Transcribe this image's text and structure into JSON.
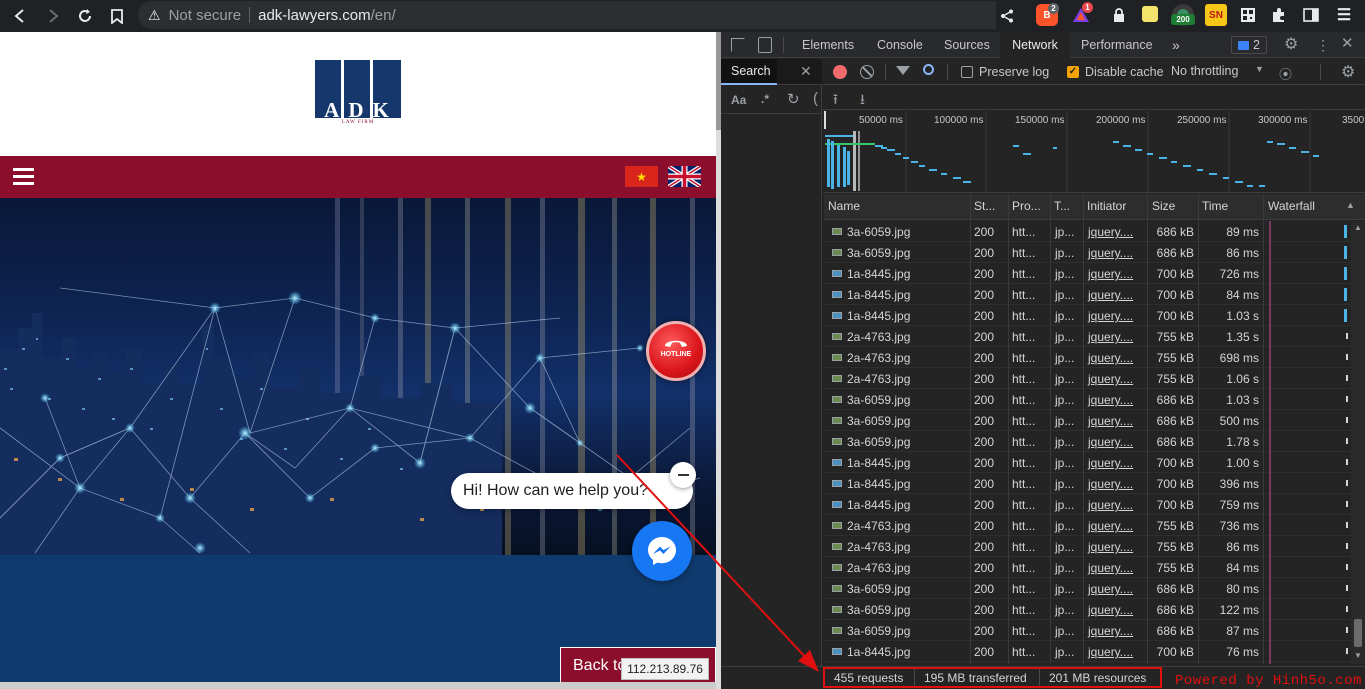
{
  "browser": {
    "security_label": "Not secure",
    "url_host": "adk-lawyers.com",
    "url_path": "/en/",
    "badge_brave": "2",
    "badge_alert": "1",
    "badge_200": "200",
    "badge_sn": "SN"
  },
  "page": {
    "logo_text": "ADK",
    "logo_sub": "LAW FIRM",
    "hotline": "HOTLINE",
    "chat_prompt": "Hi! How can we help you?",
    "back_button": "Back to",
    "ip_tooltip": "112.213.89.76",
    "colors": {
      "brand": "#8b0e2c",
      "navy": "#0f3a6e",
      "messenger": "#1877f2"
    }
  },
  "devtools": {
    "tabs": [
      "Elements",
      "Console",
      "Sources",
      "Network",
      "Performance"
    ],
    "active_tab": "Network",
    "issues_count": "2",
    "search_label": "Search",
    "preserve_log": "Preserve log",
    "disable_cache": "Disable cache",
    "throttling": "No throttling",
    "timeline_ticks": [
      "50000 ms",
      "100000 ms",
      "150000 ms",
      "200000 ms",
      "250000 ms",
      "300000 ms",
      "3500"
    ],
    "columns": [
      "Name",
      "St...",
      "Pro...",
      "T...",
      "Initiator",
      "Size",
      "Time",
      "Waterfall"
    ],
    "rows": [
      {
        "name": "3a-6059.jpg",
        "status": "200",
        "proto": "htt...",
        "type": "jp...",
        "initiator": "jquery....",
        "size": "686 kB",
        "time": "89 ms"
      },
      {
        "name": "3a-6059.jpg",
        "status": "200",
        "proto": "htt...",
        "type": "jp...",
        "initiator": "jquery....",
        "size": "686 kB",
        "time": "86 ms"
      },
      {
        "name": "1a-8445.jpg",
        "status": "200",
        "proto": "htt...",
        "type": "jp...",
        "initiator": "jquery....",
        "size": "700 kB",
        "time": "726 ms"
      },
      {
        "name": "1a-8445.jpg",
        "status": "200",
        "proto": "htt...",
        "type": "jp...",
        "initiator": "jquery....",
        "size": "700 kB",
        "time": "84 ms"
      },
      {
        "name": "1a-8445.jpg",
        "status": "200",
        "proto": "htt...",
        "type": "jp...",
        "initiator": "jquery....",
        "size": "700 kB",
        "time": "1.03 s"
      },
      {
        "name": "2a-4763.jpg",
        "status": "200",
        "proto": "htt...",
        "type": "jp...",
        "initiator": "jquery....",
        "size": "755 kB",
        "time": "1.35 s"
      },
      {
        "name": "2a-4763.jpg",
        "status": "200",
        "proto": "htt...",
        "type": "jp...",
        "initiator": "jquery....",
        "size": "755 kB",
        "time": "698 ms"
      },
      {
        "name": "2a-4763.jpg",
        "status": "200",
        "proto": "htt...",
        "type": "jp...",
        "initiator": "jquery....",
        "size": "755 kB",
        "time": "1.06 s"
      },
      {
        "name": "3a-6059.jpg",
        "status": "200",
        "proto": "htt...",
        "type": "jp...",
        "initiator": "jquery....",
        "size": "686 kB",
        "time": "1.03 s"
      },
      {
        "name": "3a-6059.jpg",
        "status": "200",
        "proto": "htt...",
        "type": "jp...",
        "initiator": "jquery....",
        "size": "686 kB",
        "time": "500 ms"
      },
      {
        "name": "3a-6059.jpg",
        "status": "200",
        "proto": "htt...",
        "type": "jp...",
        "initiator": "jquery....",
        "size": "686 kB",
        "time": "1.78 s"
      },
      {
        "name": "1a-8445.jpg",
        "status": "200",
        "proto": "htt...",
        "type": "jp...",
        "initiator": "jquery....",
        "size": "700 kB",
        "time": "1.00 s"
      },
      {
        "name": "1a-8445.jpg",
        "status": "200",
        "proto": "htt...",
        "type": "jp...",
        "initiator": "jquery....",
        "size": "700 kB",
        "time": "396 ms"
      },
      {
        "name": "1a-8445.jpg",
        "status": "200",
        "proto": "htt...",
        "type": "jp...",
        "initiator": "jquery....",
        "size": "700 kB",
        "time": "759 ms"
      },
      {
        "name": "2a-4763.jpg",
        "status": "200",
        "proto": "htt...",
        "type": "jp...",
        "initiator": "jquery....",
        "size": "755 kB",
        "time": "736 ms"
      },
      {
        "name": "2a-4763.jpg",
        "status": "200",
        "proto": "htt...",
        "type": "jp...",
        "initiator": "jquery....",
        "size": "755 kB",
        "time": "86 ms"
      },
      {
        "name": "2a-4763.jpg",
        "status": "200",
        "proto": "htt...",
        "type": "jp...",
        "initiator": "jquery....",
        "size": "755 kB",
        "time": "84 ms"
      },
      {
        "name": "3a-6059.jpg",
        "status": "200",
        "proto": "htt...",
        "type": "jp...",
        "initiator": "jquery....",
        "size": "686 kB",
        "time": "80 ms"
      },
      {
        "name": "3a-6059.jpg",
        "status": "200",
        "proto": "htt...",
        "type": "jp...",
        "initiator": "jquery....",
        "size": "686 kB",
        "time": "122 ms"
      },
      {
        "name": "3a-6059.jpg",
        "status": "200",
        "proto": "htt...",
        "type": "jp...",
        "initiator": "jquery....",
        "size": "686 kB",
        "time": "87 ms"
      },
      {
        "name": "1a-8445.jpg",
        "status": "200",
        "proto": "htt...",
        "type": "jp...",
        "initiator": "jquery....",
        "size": "700 kB",
        "time": "76 ms"
      }
    ],
    "summary": {
      "requests": "455 requests",
      "transferred": "195 MB transferred",
      "resources": "201 MB resources"
    }
  },
  "watermark": "Powered by Hinh5o.com"
}
